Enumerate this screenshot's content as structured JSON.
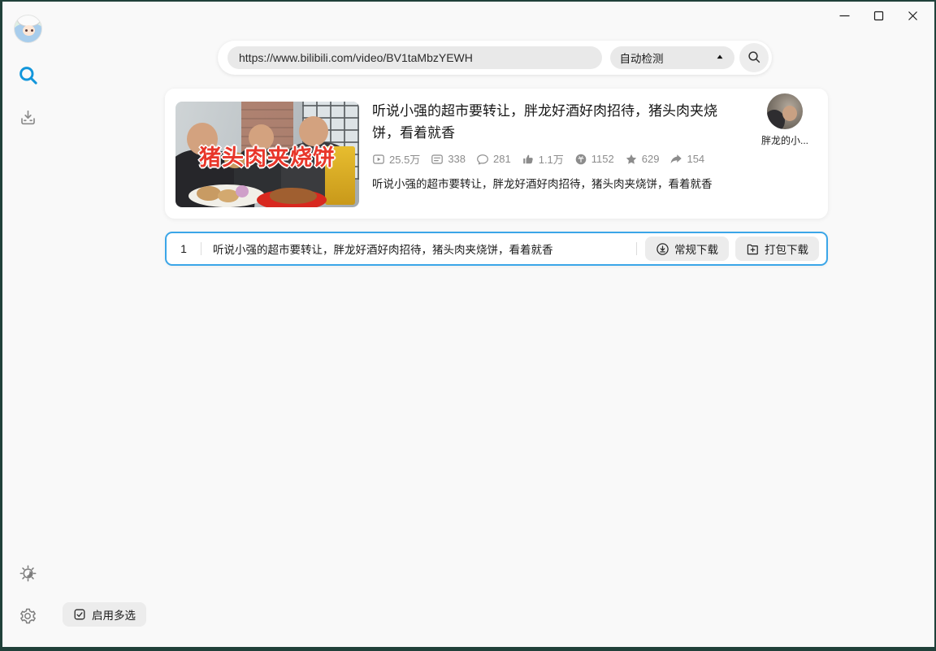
{
  "colors": {
    "accent_blue": "#1296db",
    "selection_border": "#3ba6e8",
    "thumb_text_red": "#e8362a"
  },
  "searchbar": {
    "url": "https://www.bilibili.com/video/BV1taMbzYEWH",
    "detect_label": "自动检测"
  },
  "video": {
    "title": "听说小强的超市要转让，胖龙好酒好肉招待，猪头肉夹烧饼，看着就香",
    "thumbnail_overlay": "猪头肉夹烧饼",
    "stats": [
      {
        "icon": "play-count-icon",
        "value": "25.5万"
      },
      {
        "icon": "danmaku-icon",
        "value": "338"
      },
      {
        "icon": "comment-icon",
        "value": "281"
      },
      {
        "icon": "like-icon",
        "value": "1.1万"
      },
      {
        "icon": "coin-icon",
        "value": "1152"
      },
      {
        "icon": "favorite-icon",
        "value": "629"
      },
      {
        "icon": "share-icon",
        "value": "154"
      }
    ],
    "description": "听说小强的超市要转让，胖龙好酒好肉招待，猪头肉夹烧饼，看着就香",
    "uploader_name": "胖龙的小..."
  },
  "download_row": {
    "index": "1",
    "title": "听说小强的超市要转让，胖龙好酒好肉招待，猪头肉夹烧饼，看着就香",
    "regular_label": "常规下载",
    "package_label": "打包下载"
  },
  "footer": {
    "multi_select_label": "启用多选"
  }
}
